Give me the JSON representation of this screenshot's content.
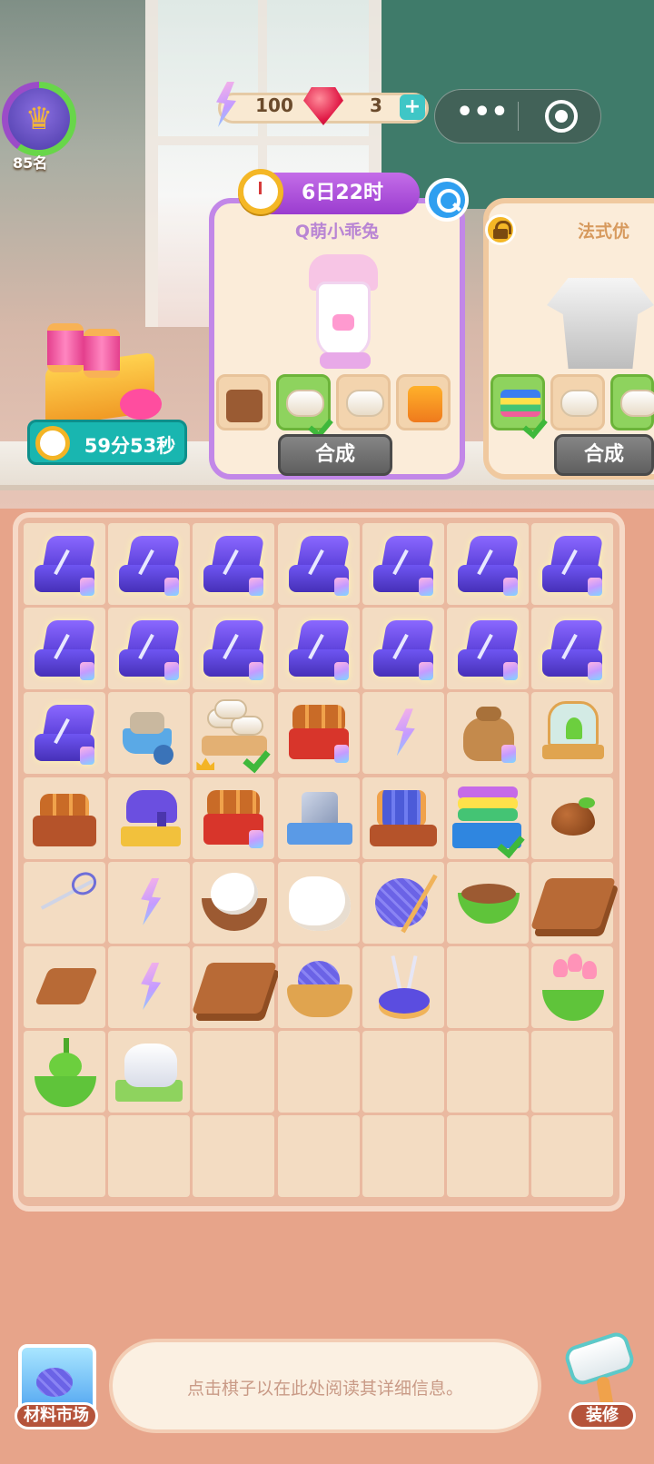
{
  "hud": {
    "rank_label": "85名",
    "energy": "100",
    "gems": "3",
    "gem_add": "+"
  },
  "mini_program": {
    "more": "•••"
  },
  "gift": {
    "timer": "59分53秒"
  },
  "orders": [
    {
      "timer": "6日22时",
      "name": "Q萌小乖兔",
      "button": "合成",
      "requirements": [
        "leather-bag",
        "towel-roll",
        "towel-roll",
        "sewing-machine"
      ],
      "fulfilled": [
        false,
        true,
        false,
        false
      ]
    },
    {
      "name": "法式优",
      "button": "合成",
      "locked": true,
      "requirements": [
        "fabric-stack",
        "towel-roll",
        "towel-roll"
      ],
      "fulfilled": [
        true,
        false,
        true
      ]
    }
  ],
  "board": {
    "rows": [
      [
        "sewing-kit",
        "sewing-kit",
        "sewing-kit",
        "sewing-kit",
        "sewing-kit",
        "sewing-kit",
        "sewing-kit"
      ],
      [
        "sewing-kit",
        "sewing-kit",
        "sewing-kit",
        "sewing-kit",
        "sewing-kit",
        "sewing-kit",
        "sewing-kit"
      ],
      [
        "sewing-kit",
        "stone-cart",
        "towel-tray",
        "log-chest",
        "energy-bolt",
        "seed-sack",
        "greenhouse"
      ],
      [
        "log-crate",
        "sewing-machine",
        "log-chest",
        "stone-block",
        "spool-frame",
        "fabric-stack",
        "seed"
      ],
      [
        "needle",
        "energy-bolt",
        "cotton-bowl",
        "cotton-fluff",
        "yarn-ball",
        "soil-bowl",
        "planks"
      ],
      [
        "plank",
        "energy-bolt",
        "planks",
        "yarn-basket",
        "pin-cushion",
        "",
        "tulip-pot"
      ],
      [
        "sprout-pot",
        "cloth-pile",
        "",
        "",
        "",
        "",
        ""
      ],
      [
        "",
        "",
        "",
        "",
        "",
        "",
        ""
      ]
    ]
  },
  "bottom": {
    "hint": "点击棋子以在此处阅读其详细信息。",
    "market_label": "材料市场",
    "decorate_label": "装修"
  },
  "colors": {
    "order_border": "#c287e8",
    "timer_teal": "#19b6b0",
    "board_bg": "#eab9a0"
  }
}
